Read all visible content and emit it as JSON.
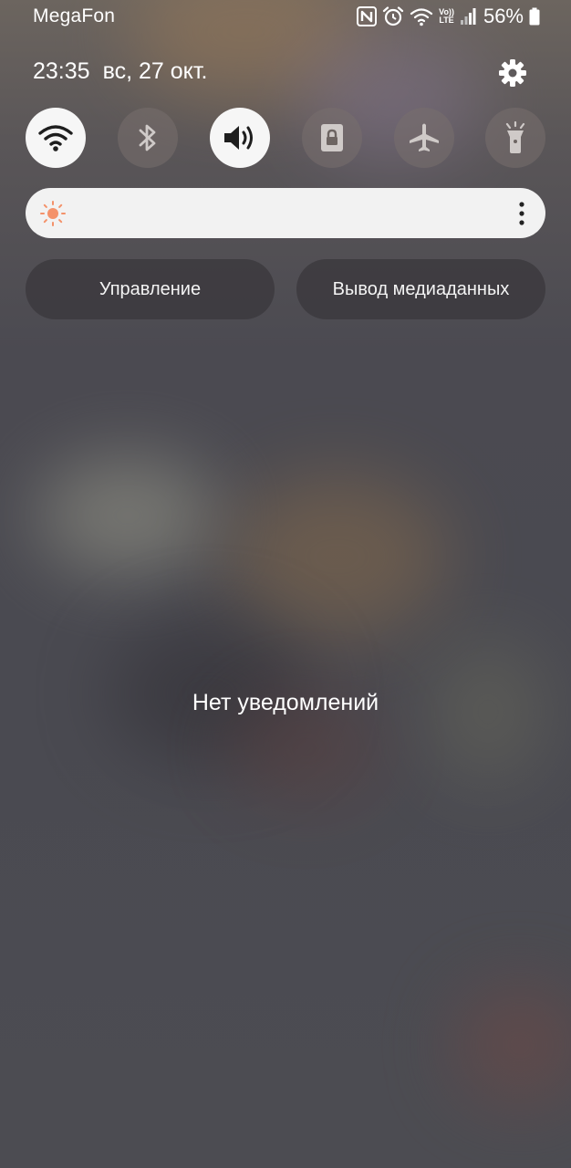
{
  "status_bar": {
    "carrier": "MegaFon",
    "battery_percent": "56%",
    "icons": [
      "nfc-icon",
      "alarm-icon",
      "wifi-icon",
      "volte-lte-icon",
      "signal-icon",
      "battery-icon"
    ],
    "volte_top": "Vo))",
    "volte_bottom": "LTE"
  },
  "header": {
    "time": "23:35",
    "date": "вс, 27 окт."
  },
  "quick_tiles": [
    {
      "name": "wifi",
      "icon": "wifi-icon",
      "active": true
    },
    {
      "name": "bluetooth",
      "icon": "bluetooth-icon",
      "active": false
    },
    {
      "name": "sound",
      "icon": "sound-icon",
      "active": true
    },
    {
      "name": "rotation-lock",
      "icon": "lock-icon",
      "active": false
    },
    {
      "name": "airplane-mode",
      "icon": "airplane-icon",
      "active": false
    },
    {
      "name": "flashlight",
      "icon": "flashlight-icon",
      "active": false
    }
  ],
  "buttons": {
    "manage": "Управление",
    "media_output": "Вывод медиаданных"
  },
  "notifications": {
    "empty_text": "Нет уведомлений"
  },
  "colors": {
    "tile_active_bg": "#f6f6f6",
    "tile_icon_active": "#1e1e1e",
    "tile_icon_inactive": "#cfcac8",
    "sun_accent": "#f4926a"
  }
}
